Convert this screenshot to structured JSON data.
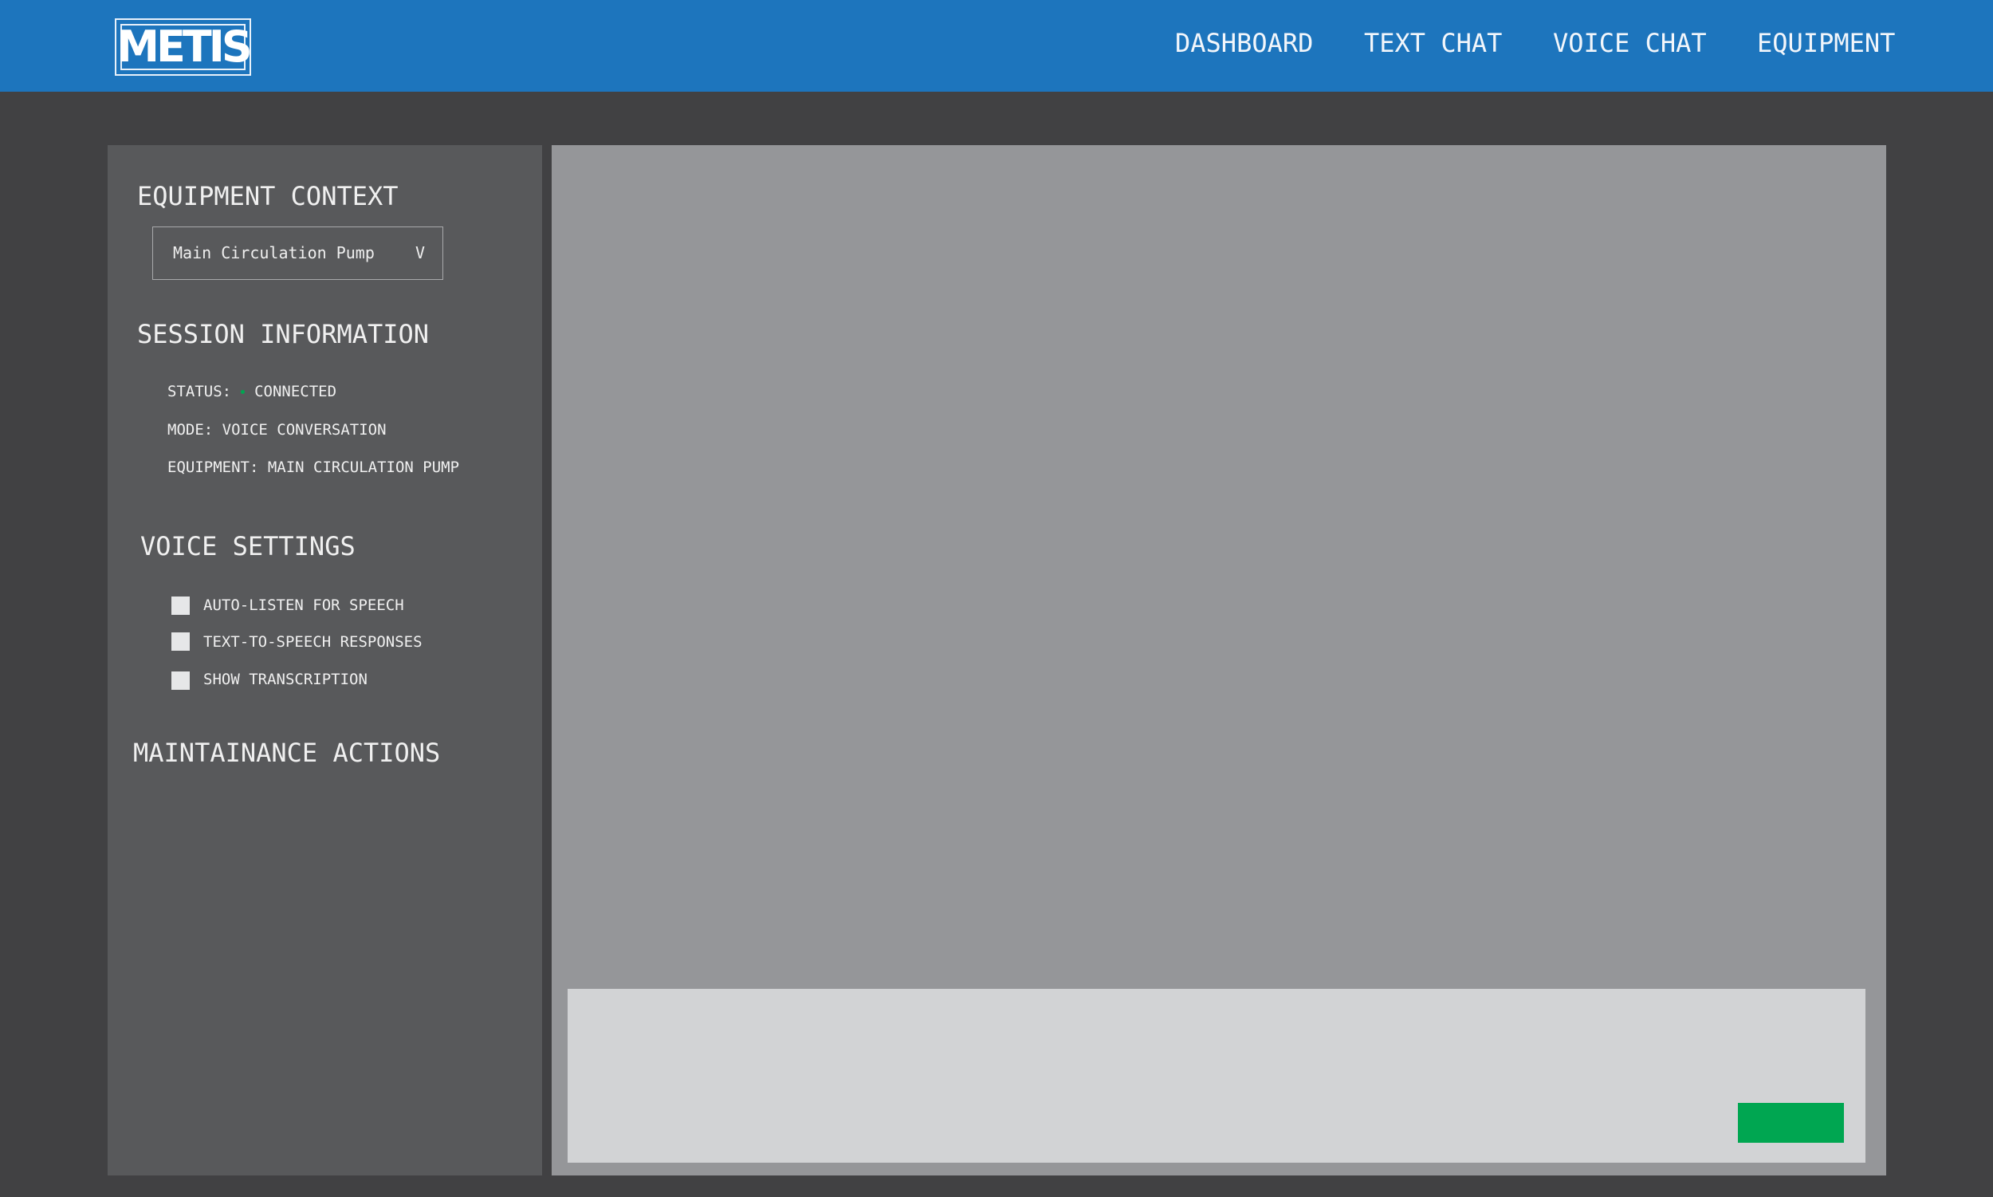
{
  "header": {
    "logo_text": "METIS",
    "nav": {
      "dashboard": "DASHBOARD",
      "text_chat": "TEXT CHAT",
      "voice_chat": "VOICE CHAT",
      "equipment": "EQUIPMENT"
    }
  },
  "sidebar": {
    "equipment_context": {
      "title": "EQUIPMENT CONTEXT",
      "selected": "Main Circulation Pump",
      "caret": "V"
    },
    "session": {
      "title": "SESSION INFORMATION",
      "status_label": "STATUS:",
      "status_value": "CONNECTED",
      "status_color": "#00a651",
      "mode": "MODE: VOICE CONVERSATION",
      "equipment": "EQUIPMENT: MAIN CIRCULATION PUMP"
    },
    "voice_settings": {
      "title": "VOICE SETTINGS",
      "options": [
        {
          "label": "AUTO-LISTEN FOR SPEECH",
          "checked": false
        },
        {
          "label": "TEXT-TO-SPEECH RESPONSES",
          "checked": false
        },
        {
          "label": "SHOW TRANSCRIPTION",
          "checked": false
        }
      ]
    },
    "maintenance": {
      "title": "MAINTAINANCE ACTIONS"
    }
  },
  "colors": {
    "header_bg": "#1d75bd",
    "page_bg": "#414143",
    "sidebar_bg": "#58595b",
    "chat_bg": "#959699",
    "input_bg": "#d2d3d5",
    "send_button": "#00a651"
  }
}
